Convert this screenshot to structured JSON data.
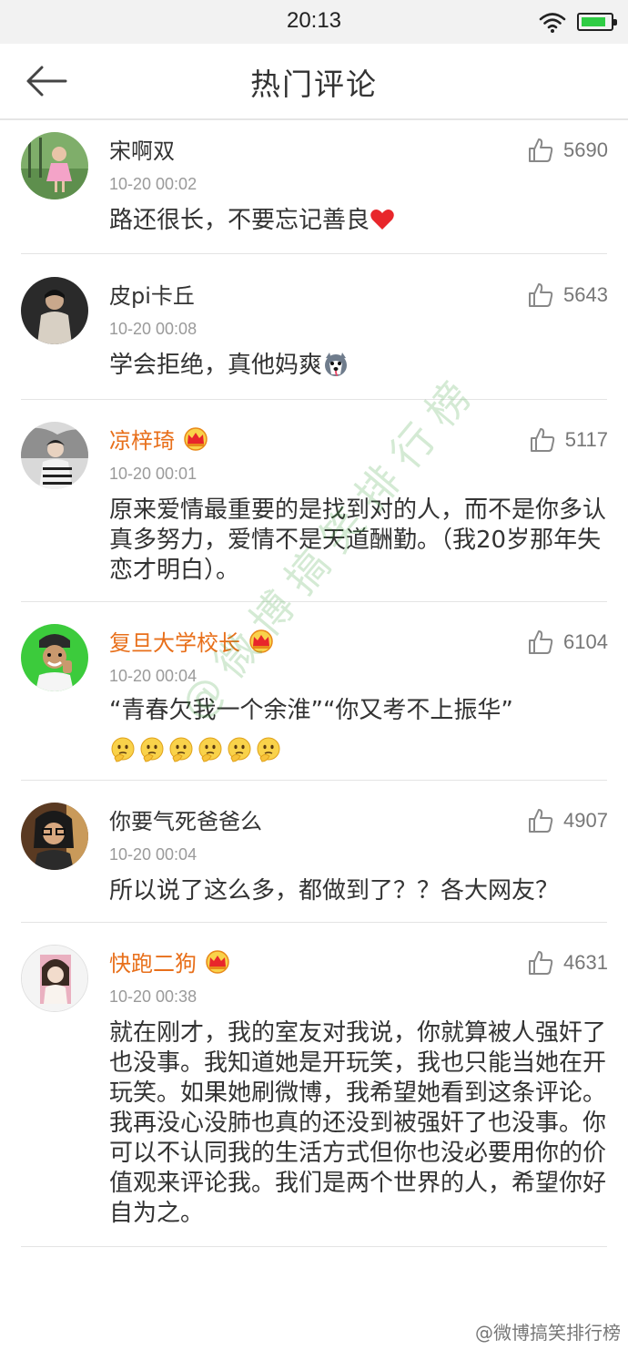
{
  "status_bar": {
    "time": "20:13"
  },
  "nav": {
    "title": "热门评论"
  },
  "comments": [
    {
      "username": "宋啊双",
      "vip": false,
      "time": "10-20 00:02",
      "likes": "5690",
      "content": "路还很长，不要忘记善良",
      "emoji": "heart"
    },
    {
      "username": "皮pi卡丘",
      "vip": false,
      "time": "10-20 00:08",
      "likes": "5643",
      "content": "学会拒绝，真他妈爽",
      "emoji": "husky"
    },
    {
      "username": "凉梓琦",
      "vip": true,
      "time": "10-20 00:01",
      "likes": "5117",
      "content": "原来爱情最重要的是找到对的人，而不是你多认真多努力，爱情不是天道酬勤。（我20岁那年失恋才明白）。",
      "emoji": ""
    },
    {
      "username": "复旦大学校长",
      "vip": true,
      "time": "10-20 00:04",
      "likes": "6104",
      "content": "“青春欠我一个余淮”“你又考不上振华”",
      "emoji": "think"
    },
    {
      "username": "你要气死爸爸么",
      "vip": false,
      "time": "10-20 00:04",
      "likes": "4907",
      "content": "所以说了这么多，都做到了？？各大网友？",
      "emoji": ""
    },
    {
      "username": "快跑二狗",
      "vip": true,
      "time": "10-20 00:38",
      "likes": "4631",
      "content": "就在刚才，我的室友对我说，你就算被人强奸了也没事。我知道她是开玩笑，我也只能当她在开玩笑。如果她刷微博，我希望她看到这条评论。我再没心没肺也真的还没到被强奸了也没事。你可以不认同我的生活方式但你也没必要用你的价值观来评论我。我们是两个世界的人，希望你好自为之。",
      "emoji": ""
    }
  ],
  "watermark": {
    "center": "@微博搞笑排行榜",
    "corner": "@微博搞笑排行榜"
  },
  "colors": {
    "vip_name": "#e86f1a",
    "watermark": "#3ca03c",
    "battery": "#2fcc44"
  }
}
